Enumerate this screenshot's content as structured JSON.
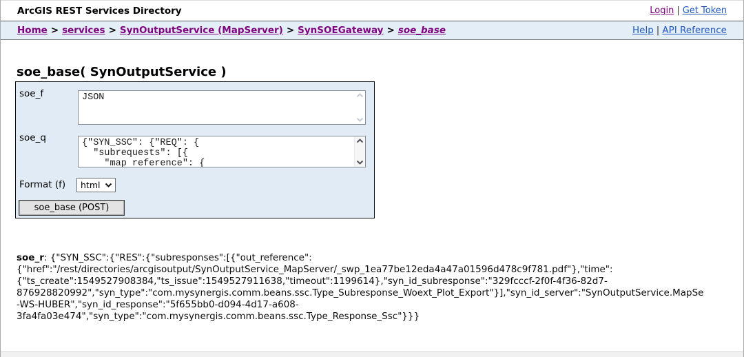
{
  "header": {
    "title": "ArcGIS REST Services Directory",
    "login_label": "Login",
    "separator": "|",
    "get_token_label": "Get Token"
  },
  "breadcrumb": {
    "items": [
      {
        "label": "Home"
      },
      {
        "label": "services"
      },
      {
        "label": "SynOutputService (MapServer)"
      },
      {
        "label": "SynSOEGateway"
      },
      {
        "label": "soe_base"
      }
    ],
    "separator": ">",
    "help_label": "Help",
    "divider": "|",
    "api_reference_label": "API Reference"
  },
  "page": {
    "title": "soe_base( SynOutputService )"
  },
  "form": {
    "soe_f": {
      "label": "soe_f",
      "value": "JSON"
    },
    "soe_q": {
      "label": "soe_q",
      "value": "{\"SYN_SSC\": {\"REQ\": {\n  \"subrequests\": [{\n    \"map reference\": {"
    },
    "format": {
      "label": "Format (f)",
      "selected_option": "html"
    },
    "submit_label": "soe_base (POST)"
  },
  "response": {
    "label": "soe_r",
    "separator": ": ",
    "lines": [
      "{\"SYN_SSC\":{\"RES\":{\"subresponses\":[{\"out_reference\":",
      "{\"href\":\"/rest/directories/arcgisoutput/SynOutputService_MapServer/_swp_1ea77be12eda4a47a01596d478c9f781.pdf\"},\"time\":",
      "{\"ts_create\":1549527908384,\"ts_issue\":1549527911638,\"timeout\":1199614},\"syn_id_subresponse\":\"329fcccf-2f0f-4f36-82d7-",
      "876928820992\",\"syn_type\":\"com.mysynergis.comm.beans.ssc.Type_Subresponse_Woext_Plot_Export\"}],\"syn_id_server\":\"SynOutputService.MapSe",
      "-WS-HUBER\",\"syn_id_response\":\"5f655bb0-d094-4d17-a608-",
      "3fa4fa03e474\",\"syn_type\":\"com.mysynergis.comm.beans.ssc.Type_Response_Ssc\"}}}"
    ]
  },
  "colors": {
    "link_blue": "#2058c0",
    "link_purple": "#800080",
    "breadcrumb_bg": "#e4eef7",
    "form_bg": "#e1ebf5"
  }
}
